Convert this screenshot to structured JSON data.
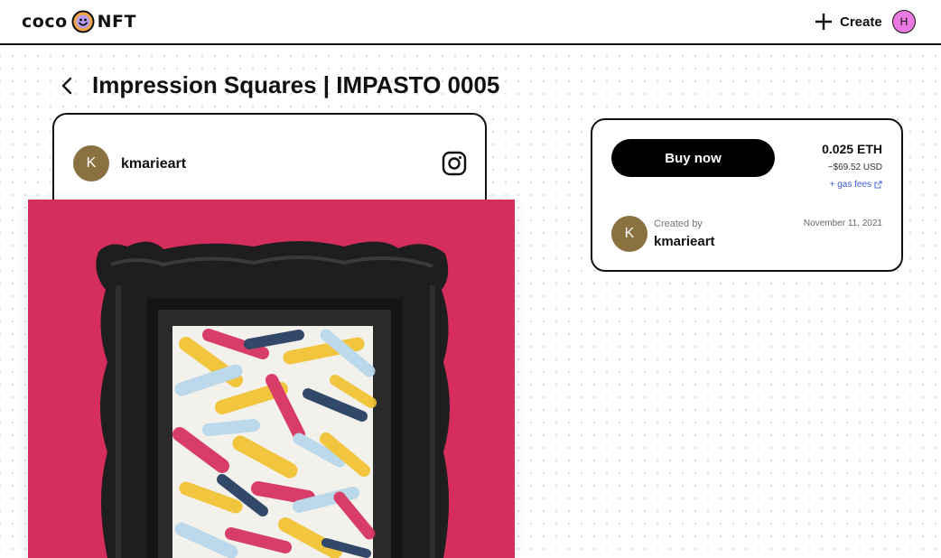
{
  "header": {
    "logo_left": "coco",
    "logo_right": "NFT",
    "logo_icon": "smiley-face-icon",
    "create_label": "Create",
    "create_icon": "plus-icon",
    "user_initial": "H",
    "user_avatar_color": "#e879e0"
  },
  "page": {
    "back_icon": "chevron-left-icon",
    "title": "Impression Squares | IMPASTO 0005"
  },
  "artist": {
    "initial": "K",
    "name": "kmarieart",
    "avatar_color": "#8a7140",
    "social_icon": "instagram-icon"
  },
  "artwork": {
    "background_color": "#d62e5c",
    "frame_color": "#1f1f1f"
  },
  "purchase": {
    "buy_label": "Buy now",
    "price_eth": "0.025 ETH",
    "price_usd": "~$69.52 USD",
    "gas_fees_label": "+ gas fees",
    "gas_fees_icon": "external-link-icon",
    "created_by_label": "Created by",
    "creator_initial": "K",
    "creator_name": "kmarieart",
    "created_date": "November 11, 2021",
    "link_color": "#3d5bdb"
  }
}
